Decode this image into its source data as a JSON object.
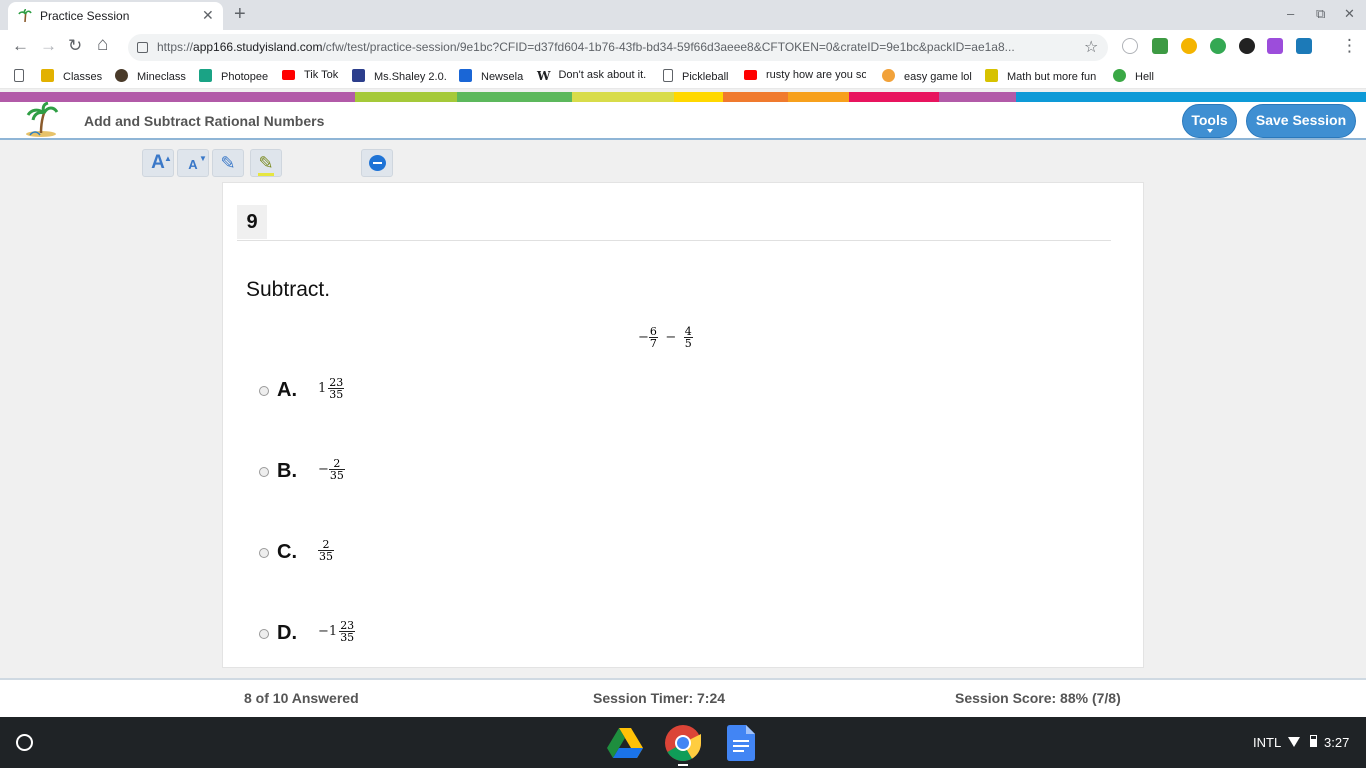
{
  "browser": {
    "tab_title": "Practice Session",
    "tab_close": "✕",
    "new_tab": "+",
    "window_controls": {
      "minimize": "–",
      "restore": "⧉",
      "close": "✕"
    },
    "nav": {
      "back": "←",
      "forward": "→",
      "reload": "↻",
      "home": "⌂",
      "star": "☆",
      "menu": "⋮"
    },
    "url_prefix": "https://",
    "url_host": "app166.studyisland.com",
    "url_path": "/cfw/test/practice-session/9e1bc?CFID=d37fd604-1b76-43fb-bd34-59f66d3aeee8&CFTOKEN=0&crateID=9e1bc&packID=ae1a8...",
    "extension_icons": [
      "clock-icon",
      "extension-icon-green",
      "drive-icon",
      "drive-icon-2",
      "person-icon",
      "puzzle-icon",
      "extension-icon-blue"
    ],
    "bookmarks": [
      {
        "label": "",
        "icon": "page-icon",
        "color": "#ffffff"
      },
      {
        "label": "Classes",
        "icon": "classroom-icon",
        "color": "#e2b100"
      },
      {
        "label": "Mineclass",
        "icon": "mineclass-icon",
        "color": "#4a3b2a"
      },
      {
        "label": "Photopee",
        "icon": "photopea-icon",
        "color": "#1aa385"
      },
      {
        "label": "Tik Tok",
        "icon": "youtube-icon",
        "color": "#ff0000"
      },
      {
        "label": "Ms.Shaley 2.0.",
        "icon": "site-icon",
        "color": "#2c3e8c"
      },
      {
        "label": "Newsela",
        "icon": "newsela-icon",
        "color": "#1a66d6"
      },
      {
        "label": "Don't ask about it.",
        "icon": "wikipedia-icon",
        "color": "#333333"
      },
      {
        "label": "Pickleball",
        "icon": "page-icon",
        "color": "#ffffff"
      },
      {
        "label": "rusty how are you so",
        "icon": "youtube-icon",
        "color": "#ff0000"
      },
      {
        "label": "easy game lol",
        "icon": "game-icon",
        "color": "#f2a23a"
      },
      {
        "label": "Math but more fun",
        "icon": "ixl-icon",
        "color": "#d7c200"
      },
      {
        "label": "Hell",
        "icon": "island-icon",
        "color": "#3aa845"
      }
    ]
  },
  "rainbow_colors": [
    "#b25aa8",
    "#a5c939",
    "#5cb85c",
    "#d8dc4a",
    "#ffd800",
    "#f07a2e",
    "#f7a01c",
    "#e8145e",
    "#b25aa8",
    "#0e9ad7"
  ],
  "app": {
    "title": "Add and Subtract Rational Numbers",
    "tools_label": "Tools",
    "save_label": "Save Session",
    "accent_color": "#3f8fd2"
  },
  "tools": [
    {
      "name": "increase-font-icon",
      "glyph": "A"
    },
    {
      "name": "decrease-font-icon",
      "glyph": "A"
    },
    {
      "name": "pencil-icon",
      "glyph": "✎"
    },
    {
      "name": "highlighter-icon",
      "glyph": "✎"
    },
    {
      "name": "chat-icon",
      "glyph": "●"
    }
  ],
  "question": {
    "number": "9",
    "prompt": "Subtract.",
    "expression": {
      "term1": {
        "sign": "−",
        "num": "6",
        "den": "7"
      },
      "operator": "−",
      "term2": {
        "num": "4",
        "den": "5"
      }
    },
    "choices": [
      {
        "letter": "A.",
        "sign": "",
        "whole": "1",
        "num": "23",
        "den": "35"
      },
      {
        "letter": "B.",
        "sign": "−",
        "whole": "",
        "num": "2",
        "den": "35"
      },
      {
        "letter": "C.",
        "sign": "",
        "whole": "",
        "num": "2",
        "den": "35"
      },
      {
        "letter": "D.",
        "sign": "−",
        "whole": "1",
        "num": "23",
        "den": "35"
      }
    ]
  },
  "status": {
    "answered": "8 of 10 Answered",
    "timer": "Session Timer: 7:24",
    "score": "Session Score: 88% (7/8)"
  },
  "shelf": {
    "apps": [
      "google-drive-icon",
      "chrome-icon",
      "google-docs-icon"
    ],
    "input_method": "INTL",
    "clock": "3:27"
  }
}
